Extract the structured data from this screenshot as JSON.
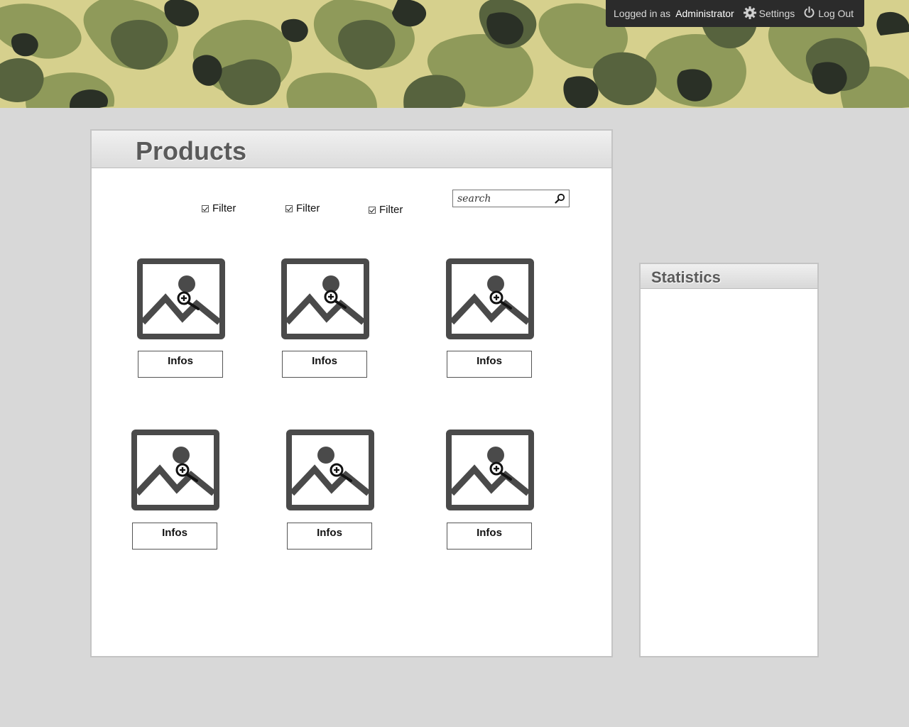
{
  "header": {
    "logged_in_label": "Logged in as",
    "user_name": "Administrator",
    "settings_label": "Settings",
    "logout_label": "Log Out",
    "icons": {
      "settings": "gear-icon",
      "logout": "power-icon"
    }
  },
  "products": {
    "title": "Products",
    "filters": [
      {
        "label": "Filter",
        "checked": true
      },
      {
        "label": "Filter",
        "checked": true
      },
      {
        "label": "Filter",
        "checked": true
      }
    ],
    "search": {
      "placeholder": "search",
      "value": ""
    },
    "items": [
      {
        "infos_label": "Infos",
        "icon": "image-zoom-icon"
      },
      {
        "infos_label": "Infos",
        "icon": "image-zoom-icon"
      },
      {
        "infos_label": "Infos",
        "icon": "image-zoom-icon"
      },
      {
        "infos_label": "Infos",
        "icon": "image-zoom-icon"
      },
      {
        "infos_label": "Infos",
        "icon": "image-zoom-icon"
      },
      {
        "infos_label": "Infos",
        "icon": "image-zoom-icon"
      }
    ]
  },
  "statistics": {
    "title": "Statistics"
  },
  "colors": {
    "background": "#d8d8d8",
    "camo_light": "#d6d08d",
    "camo_mid": "#8f9a5a",
    "camo_dark": "#57633e",
    "camo_black": "#2a3026",
    "userbar": "#2b2b2b",
    "panel_title": "#5a5a5a"
  }
}
